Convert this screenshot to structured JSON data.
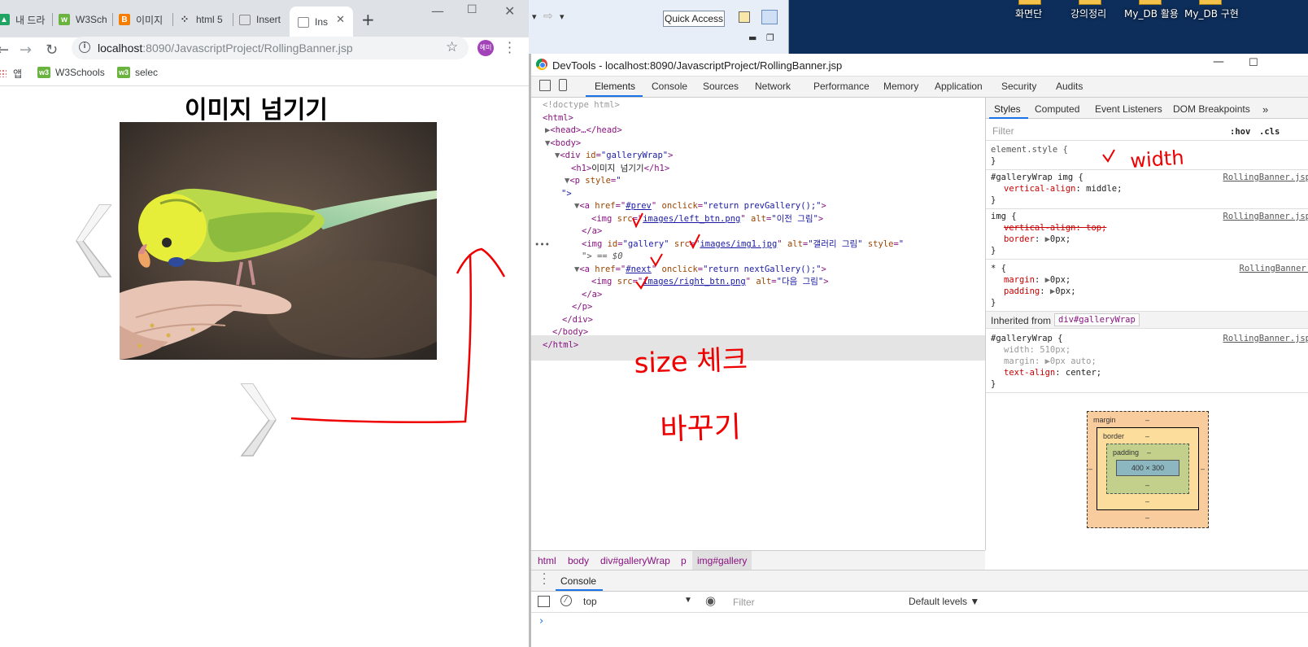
{
  "browser": {
    "tabs": [
      {
        "label": "내 드라",
        "favicon": "drive-icon",
        "color": "#1fa463"
      },
      {
        "label": "W3Sch",
        "favicon": "w3schools-icon",
        "color": "#6bb33f"
      },
      {
        "label": "이미지",
        "favicon": "blogger-icon",
        "color": "#f57d00"
      },
      {
        "label": "html 5",
        "favicon": "dots-icon",
        "color": "#333333"
      },
      {
        "label": "Insert",
        "favicon": "page-icon",
        "color": "#888888"
      },
      {
        "label": "Ins",
        "favicon": "page-icon",
        "color": "#888888",
        "active": true
      }
    ],
    "new_tab": "+",
    "url_host": "localhost",
    "url_rest": ":8090/JavascriptProject/RollingBanner.jsp",
    "profile_initials": "혜미",
    "bookmarks": [
      {
        "label": "앱"
      },
      {
        "label": "W3Schools"
      },
      {
        "label": "selec"
      }
    ]
  },
  "page": {
    "heading": "이미지 넘기기"
  },
  "desktop": {
    "icons": [
      "화면단",
      "강의정리",
      "My_DB 활용",
      "My_DB 구현"
    ],
    "quick_access": "Quick Access"
  },
  "devtools": {
    "title": "DevTools - localhost:8090/JavascriptProject/RollingBanner.jsp",
    "tabs": [
      "Elements",
      "Console",
      "Sources",
      "Network",
      "Performance",
      "Memory",
      "Application",
      "Security",
      "Audits"
    ],
    "active_tab": "Elements",
    "dom": {
      "doctype": "<!doctype html>",
      "html_open": "<html>",
      "head": "<head>…</head>",
      "body_open": "<body>",
      "div_open_tag": "<div ",
      "div_id_attr": "id",
      "div_id_val": "\"galleryWrap\"",
      "h1_open": "<h1>",
      "h1_text": "이미지 넘기기",
      "h1_close": "</h1>",
      "p_open": "<p ",
      "p_style_attr": "style",
      "p_style_val": "\"",
      "p_style_close": "\">",
      "a_prev_href": "#prev",
      "a_prev_onclick": "\"return prevGallery();\"",
      "img_left_src": "images/left_btn.png",
      "img_left_alt": "\"이전 그림\"",
      "a_close": "</a>",
      "img_gallery_id": "\"gallery\"",
      "img_gallery_src": "images/img1.jpg",
      "img_gallery_alt": "\"갤러리 그림\"",
      "img_gallery_style": "\"",
      "selected_suffix": "\"> == $0",
      "a_next_href": "#next",
      "a_next_onclick": "\"return nextGallery();\"",
      "img_right_src": "images/right_btn.png",
      "img_right_alt": "\"다음 그림\"",
      "p_close": "</p>",
      "div_close": "</div>",
      "body_close": "</body>",
      "html_close": "</html>"
    },
    "styles": {
      "tabs": [
        "Styles",
        "Computed",
        "Event Listeners",
        "DOM Breakpoints"
      ],
      "filter_placeholder": "Filter",
      "hov": ":hov",
      "cls": ".cls",
      "element_style": "element.style {",
      "rules": [
        {
          "selector": "#galleryWrap img {",
          "source": "RollingBanner.jsp",
          "props": [
            {
              "name": "vertical-align",
              "value": "middle;"
            }
          ]
        },
        {
          "selector": "img {",
          "source": "RollingBanner.jsp",
          "props": [
            {
              "name": "vertical-align: top;",
              "value": ""
            },
            {
              "name": "border",
              "value": "0px;"
            }
          ]
        },
        {
          "selector": "* {",
          "source": "RollingBanner.jsp",
          "props": [
            {
              "name": "margin",
              "value": "0px;"
            },
            {
              "name": "padding",
              "value": "0px;"
            }
          ]
        }
      ],
      "inherited_label": "Inherited from",
      "inherited_from": "div#galleryWrap",
      "inherited_rule": {
        "selector": "#galleryWrap {",
        "source": "RollingBanner.jsp",
        "props": [
          {
            "name": "width",
            "value": "510px;"
          },
          {
            "name": "margin",
            "value": "0px auto;"
          },
          {
            "name": "text-align",
            "value": "center;"
          }
        ]
      },
      "box_model": {
        "margin": "margin",
        "border": "border",
        "padding": "padding",
        "content": "400 × 300",
        "dash": "–"
      }
    },
    "breadcrumbs": [
      "html",
      "body",
      "div#galleryWrap",
      "p",
      "img#gallery"
    ],
    "console": {
      "title": "Console",
      "context": "top",
      "filter_placeholder": "Filter",
      "levels": "Default levels ▼",
      "prompt": "›"
    }
  },
  "annotations": {
    "size_check": "size 체크",
    "translate": "바꾸기",
    "width": "width"
  }
}
